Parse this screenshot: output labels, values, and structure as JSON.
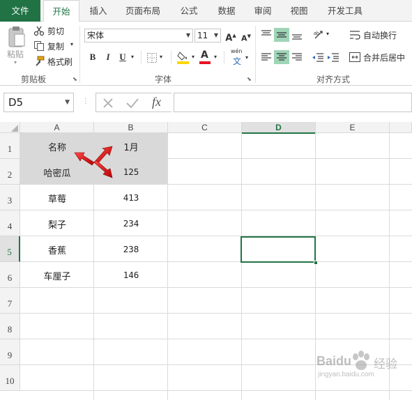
{
  "tabs": {
    "file": "文件",
    "home": "开始",
    "insert": "插入",
    "page_layout": "页面布局",
    "formulas": "公式",
    "data": "数据",
    "review": "审阅",
    "view": "视图",
    "developer": "开发工具"
  },
  "ribbon": {
    "clipboard": {
      "paste": "粘贴",
      "cut": "剪切",
      "copy": "复制",
      "format_painter": "格式刷",
      "group_label": "剪贴板"
    },
    "font": {
      "font_name": "宋体",
      "font_size": "11",
      "grow": "A",
      "shrink": "A",
      "bold": "B",
      "italic": "I",
      "underline": "U",
      "font_color_letter": "A",
      "wen": "wén",
      "wen_char": "文",
      "group_label": "字体"
    },
    "alignment": {
      "wrap_text": "自动换行",
      "merge_center": "合并后居中",
      "group_label": "对齐方式"
    },
    "colors": {
      "accent": "#217346",
      "selected_align": "#9fd5b7",
      "fill_yellow": "#ffd700",
      "font_red": "#e81123"
    }
  },
  "formula_bar": {
    "name_box": "D5",
    "fx": "fx",
    "value": ""
  },
  "sheet": {
    "columns": [
      "A",
      "B",
      "C",
      "D",
      "E"
    ],
    "rows": [
      "1",
      "2",
      "3",
      "4",
      "5",
      "6",
      "7",
      "8",
      "9",
      "10"
    ],
    "selected_cell": "D5",
    "cells": {
      "A1": "名称",
      "B1": "1月",
      "A2": "哈密瓜",
      "B2": "125",
      "A3": "草莓",
      "B3": "413",
      "A4": "梨子",
      "B4": "234",
      "A5": "香蕉",
      "B5": "238",
      "A6": "车厘子",
      "B6": "146"
    },
    "shaded_fill": "#d9d9d9"
  },
  "watermark": {
    "brand": "Baidu",
    "brand_cn": "经验",
    "url": "jingyan.baidu.com"
  }
}
